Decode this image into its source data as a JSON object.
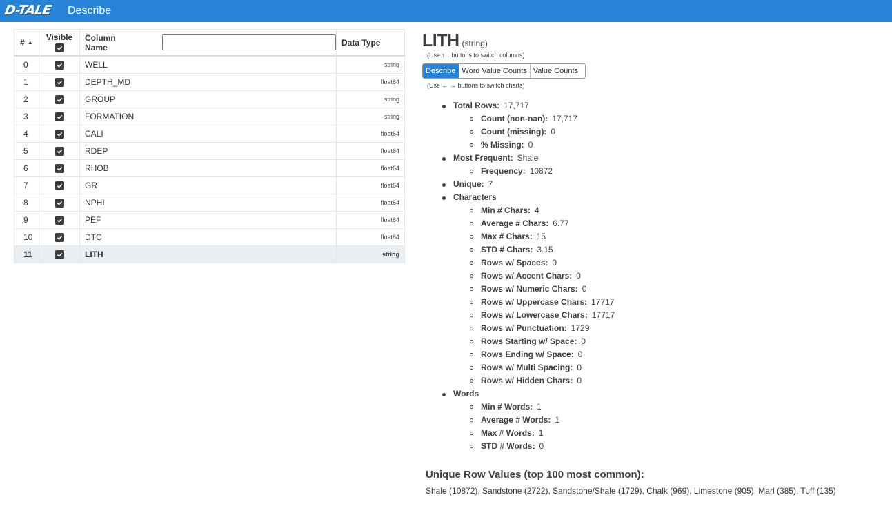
{
  "header": {
    "logo_text": "D-TALE",
    "title": "Describe"
  },
  "columns_table": {
    "headers": {
      "index": "#",
      "visible": "Visible",
      "name": "Column Name",
      "type": "Data Type"
    },
    "filter_value": "",
    "rows": [
      {
        "index": "0",
        "name": "WELL",
        "type": "string",
        "visible": true,
        "selected": false
      },
      {
        "index": "1",
        "name": "DEPTH_MD",
        "type": "float64",
        "visible": true,
        "selected": false
      },
      {
        "index": "2",
        "name": "GROUP",
        "type": "string",
        "visible": true,
        "selected": false
      },
      {
        "index": "3",
        "name": "FORMATION",
        "type": "string",
        "visible": true,
        "selected": false
      },
      {
        "index": "4",
        "name": "CALI",
        "type": "float64",
        "visible": true,
        "selected": false
      },
      {
        "index": "5",
        "name": "RDEP",
        "type": "float64",
        "visible": true,
        "selected": false
      },
      {
        "index": "6",
        "name": "RHOB",
        "type": "float64",
        "visible": true,
        "selected": false
      },
      {
        "index": "7",
        "name": "GR",
        "type": "float64",
        "visible": true,
        "selected": false
      },
      {
        "index": "8",
        "name": "NPHI",
        "type": "float64",
        "visible": true,
        "selected": false
      },
      {
        "index": "9",
        "name": "PEF",
        "type": "float64",
        "visible": true,
        "selected": false
      },
      {
        "index": "10",
        "name": "DTC",
        "type": "float64",
        "visible": true,
        "selected": false
      },
      {
        "index": "11",
        "name": "LITH",
        "type": "string",
        "visible": true,
        "selected": true
      }
    ]
  },
  "details": {
    "column_name": "LITH",
    "column_dtype": "(string)",
    "column_hint": "(Use ↑ ↓ buttons to switch columns)",
    "tabs": [
      "Describe",
      "Word Value Counts",
      "Value Counts"
    ],
    "active_tab": "Describe",
    "chart_hint": "(Use ← → buttons to switch charts)",
    "stats": [
      {
        "label": "Total Rows:",
        "value": "17,717",
        "children": [
          {
            "label": "Count (non-nan):",
            "value": "17,717"
          },
          {
            "label": "Count (missing):",
            "value": "0"
          },
          {
            "label": "% Missing:",
            "value": "0"
          }
        ]
      },
      {
        "label": "Most Frequent:",
        "value": "Shale",
        "children": [
          {
            "label": "Frequency:",
            "value": "10872"
          }
        ]
      },
      {
        "label": "Unique:",
        "value": "7",
        "children": []
      },
      {
        "label": "Characters",
        "value": "",
        "children": [
          {
            "label": "Min # Chars:",
            "value": "4"
          },
          {
            "label": "Average # Chars:",
            "value": "6.77"
          },
          {
            "label": "Max # Chars:",
            "value": "15"
          },
          {
            "label": "STD # Chars:",
            "value": "3.15"
          },
          {
            "label": "Rows w/ Spaces:",
            "value": "0"
          },
          {
            "label": "Rows w/ Accent Chars:",
            "value": "0"
          },
          {
            "label": "Rows w/ Numeric Chars:",
            "value": "0"
          },
          {
            "label": "Rows w/ Uppercase Chars:",
            "value": "17717"
          },
          {
            "label": "Rows w/ Lowercase Chars:",
            "value": "17717"
          },
          {
            "label": "Rows w/ Punctuation:",
            "value": "1729"
          },
          {
            "label": "Rows Starting w/ Space:",
            "value": "0"
          },
          {
            "label": "Rows Ending w/ Space:",
            "value": "0"
          },
          {
            "label": "Rows w/ Multi Spacing:",
            "value": "0"
          },
          {
            "label": "Rows w/ Hidden Chars:",
            "value": "0"
          }
        ]
      },
      {
        "label": "Words",
        "value": "",
        "children": [
          {
            "label": "Min # Words:",
            "value": "1"
          },
          {
            "label": "Average # Words:",
            "value": "1"
          },
          {
            "label": "Max # Words:",
            "value": "1"
          },
          {
            "label": "STD # Words:",
            "value": "0"
          }
        ]
      }
    ],
    "unique_title": "Unique Row Values (top 100 most common):",
    "unique_values": "Shale (10872), Sandstone (2722), Sandstone/Shale (1729), Chalk (969), Limestone (905), Marl (385), Tuff (135)"
  }
}
